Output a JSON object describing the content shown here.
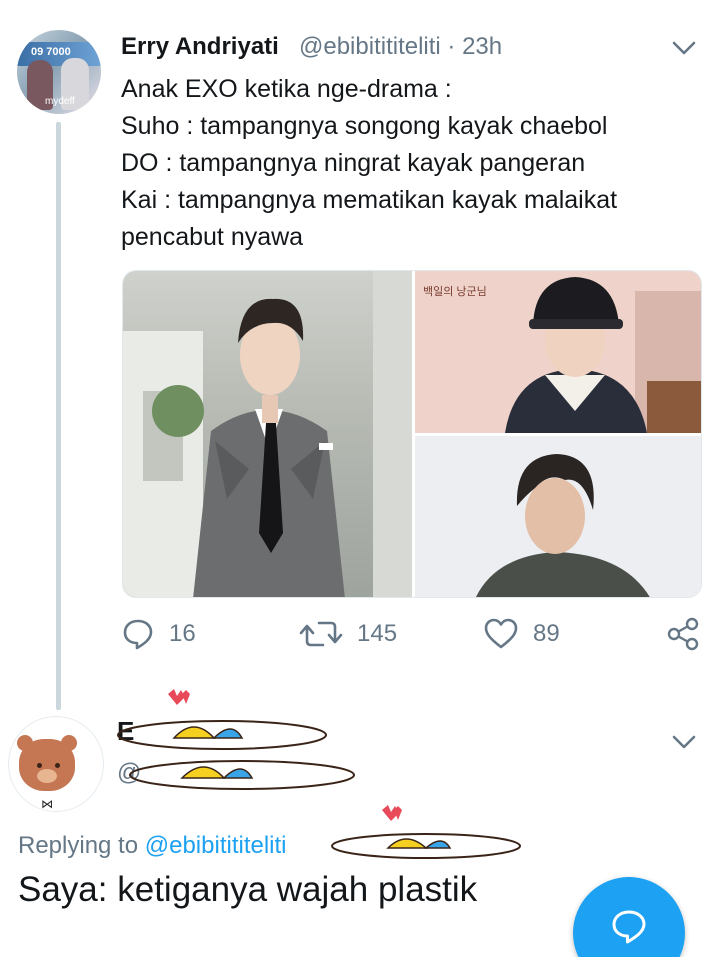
{
  "tweet": {
    "author_name": "Erry Andriyati",
    "handle_time": "@ebibitititeliti · 23h",
    "avatar_text": "09 7000",
    "avatar_logo": "mydeff",
    "lines": [
      "Anak EXO ketika nge-drama :",
      "Suho : tampangnya songong kayak chaebol",
      "DO : tampangnya ningrat kayak pangeran",
      "Kai : tampangnya mematikan kayak malaikat",
      "pencabut nyawa"
    ],
    "media_label": "백일의 낭군님",
    "actions": {
      "replies": "16",
      "retweets": "145",
      "likes": "89"
    }
  },
  "reply": {
    "replying_prefix": "Replying to ",
    "replying_handle": "@ebibitititeliti",
    "text": "Saya: ketiganya wajah plastik"
  },
  "icons": {
    "reply": "reply-icon",
    "retweet": "retweet-icon",
    "like": "heart-icon",
    "share": "share-icon",
    "chevron": "chevron-down-icon",
    "compose": "compose-reply-icon"
  },
  "colors": {
    "accent": "#1da1f2",
    "muted": "#657786",
    "text": "#14171a",
    "thread_line": "#ccd6dd"
  }
}
